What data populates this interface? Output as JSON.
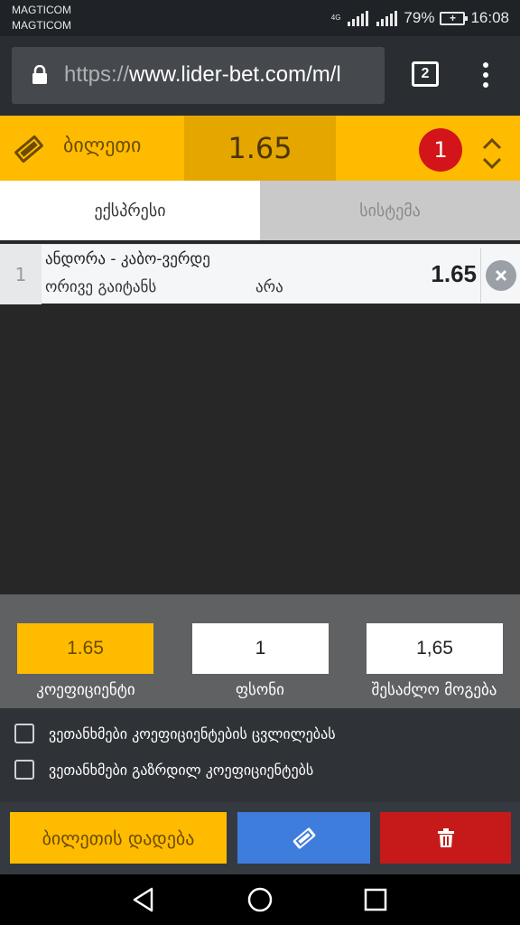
{
  "status_bar": {
    "carrier_1": "MAGTICOM",
    "carrier_2": "MAGTICOM",
    "network_type": "4G",
    "battery": "79%",
    "time": "16:08"
  },
  "browser": {
    "url_scheme": "https://",
    "url_rest": "www.lider-bet.com/m/l",
    "tab_count": "2"
  },
  "ticket": {
    "title": "ბილეთი",
    "total_odds": "1.65",
    "bet_count": "1"
  },
  "tabs": [
    {
      "label": "ექსპრესი",
      "active": true
    },
    {
      "label": "სისტემა",
      "active": false
    }
  ],
  "bets": [
    {
      "index": "1",
      "event": "ანდორა - კაბო-ვერდე",
      "market": "ორივე გაიტანს",
      "outcome": "არა",
      "odds": "1.65"
    }
  ],
  "stake": {
    "odds_value": "1.65",
    "odds_label": "კოეფიციენტი",
    "amount_value": "1",
    "amount_label": "ფსონი",
    "win_value": "1,65",
    "win_label": "შესაძლო მოგება"
  },
  "options": [
    {
      "label": "ვეთანხმები კოეფიციენტების ცვლილებას",
      "checked": false
    },
    {
      "label": "ვეთანხმები გაზრდილ კოეფიციენტებს",
      "checked": false
    }
  ],
  "actions": {
    "place_label": "ბილეთის დადება",
    "ticket_icon": "ticket-icon",
    "delete_icon": "trash-icon"
  },
  "colors": {
    "accent": "#ffbb00",
    "badge": "#d3141a",
    "blue_button": "#3f7ddd",
    "red_button": "#c61a1a"
  }
}
